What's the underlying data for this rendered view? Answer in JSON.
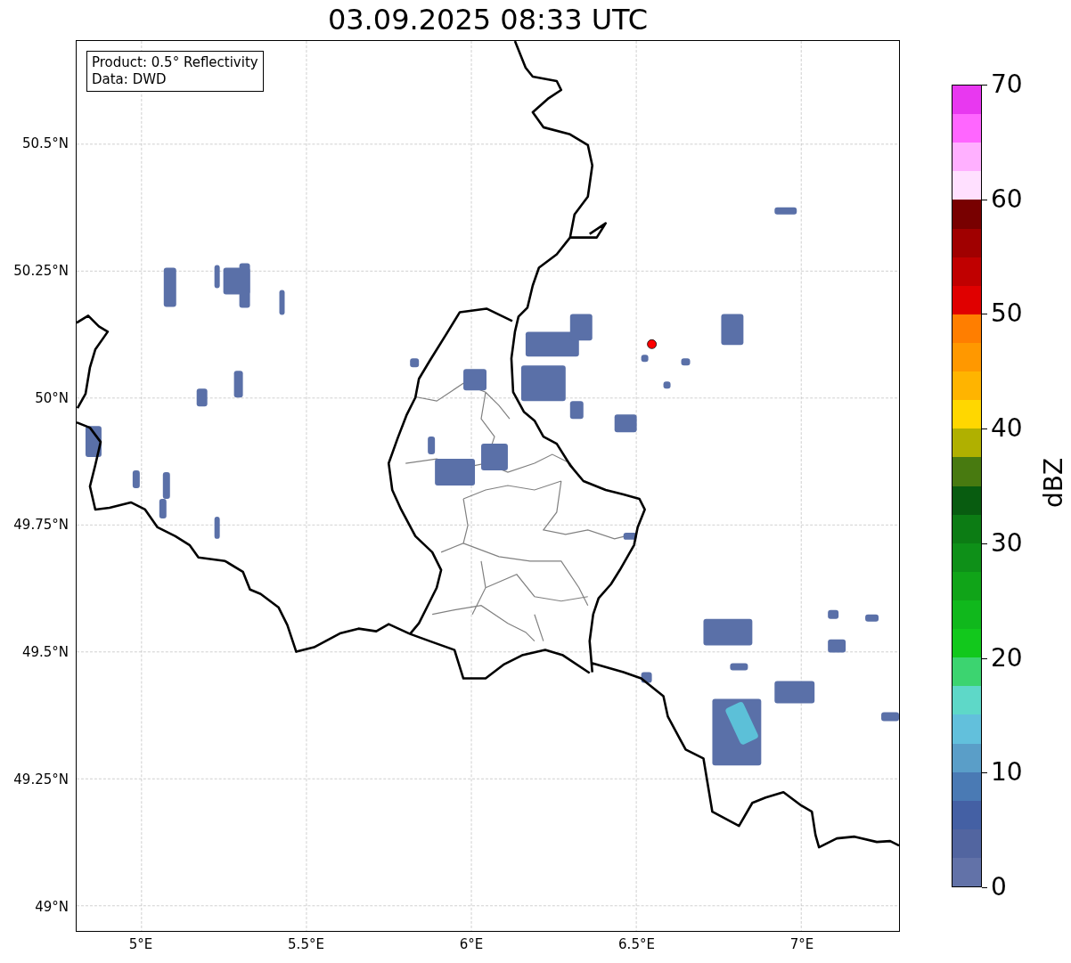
{
  "title": "03.09.2025 08:33 UTC",
  "info_box": [
    "Product: 0.5° Reflectivity",
    "Data: DWD"
  ],
  "map": {
    "lat_ticks": [
      "50.5°N",
      "50.25°N",
      "50°N",
      "49.75°N",
      "49.5°N",
      "49.25°N",
      "49°N"
    ],
    "lon_ticks": [
      "5°E",
      "5.5°E",
      "6°E",
      "6.5°E",
      "7°E"
    ]
  },
  "colorbar": {
    "label": "dBZ",
    "ticks": [
      "70",
      "60",
      "50",
      "40",
      "30",
      "20",
      "10",
      "0"
    ],
    "bands": [
      {
        "color": "#e838f0"
      },
      {
        "color": "#ff66ff"
      },
      {
        "color": "#ffb0ff"
      },
      {
        "color": "#ffe0ff"
      },
      {
        "color": "#780000"
      },
      {
        "color": "#a00000"
      },
      {
        "color": "#c00000"
      },
      {
        "color": "#e00000"
      },
      {
        "color": "#ff7e00"
      },
      {
        "color": "#ff9800"
      },
      {
        "color": "#ffb400"
      },
      {
        "color": "#ffd700"
      },
      {
        "color": "#b0b000"
      },
      {
        "color": "#487a10"
      },
      {
        "color": "#085c10"
      },
      {
        "color": "#0c7c14"
      },
      {
        "color": "#0e9018"
      },
      {
        "color": "#10a418"
      },
      {
        "color": "#10b81c"
      },
      {
        "color": "#12c81c"
      },
      {
        "color": "#3cd470"
      },
      {
        "color": "#5ed8c8"
      },
      {
        "color": "#62c0dc"
      },
      {
        "color": "#5a9ec8"
      },
      {
        "color": "#4a7ab4"
      },
      {
        "color": "#4460a4"
      },
      {
        "color": "#5265a0"
      },
      {
        "color": "#6272a8"
      }
    ]
  }
}
